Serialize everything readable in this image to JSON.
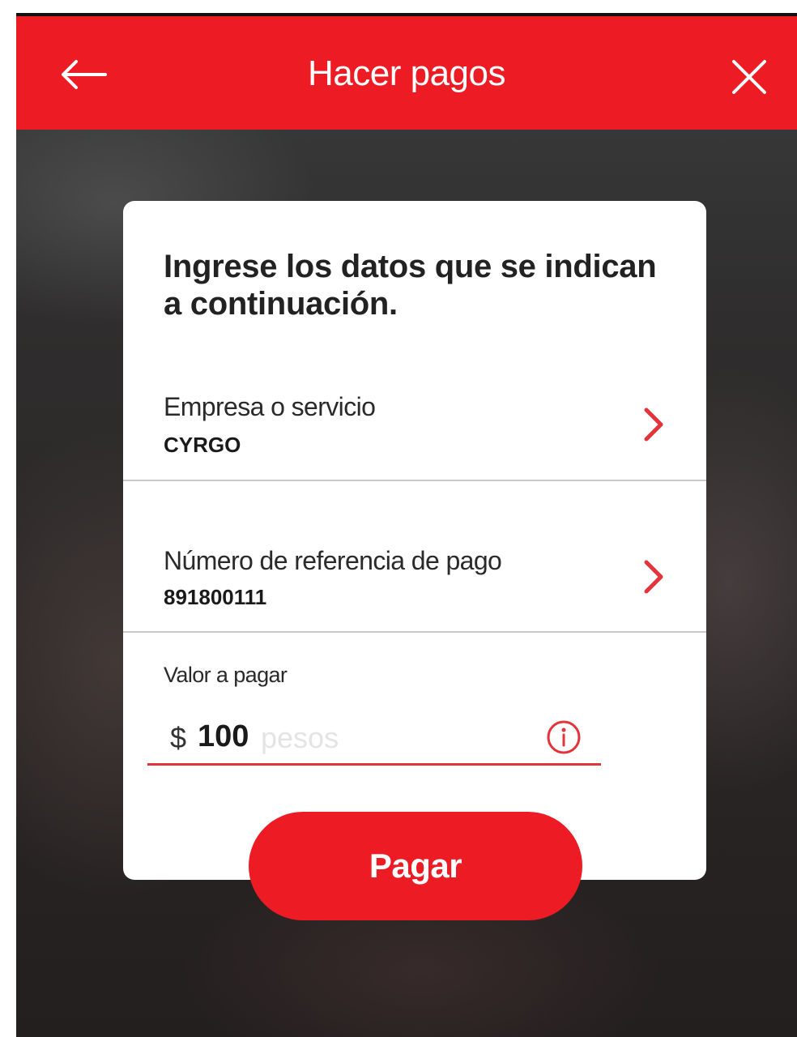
{
  "header": {
    "title": "Hacer pagos",
    "back_icon": "arrow-left-icon",
    "close_icon": "close-icon",
    "color": "#ed1c24"
  },
  "form": {
    "heading": "Ingrese los datos que se indican a continuación.",
    "company": {
      "label": "Empresa o servicio",
      "value": "CYRGO",
      "icon": "chevron-right-icon"
    },
    "reference": {
      "label": "Número de referencia de pago",
      "value": "891800111",
      "icon": "chevron-right-icon"
    },
    "amount": {
      "label": "Valor a pagar",
      "currency": "$",
      "value": "100",
      "unit": "pesos",
      "icon": "info-icon"
    }
  },
  "pay_button": {
    "label": "Pagar"
  },
  "colors": {
    "accent": "#ed1c24",
    "card": "#ffffff"
  }
}
